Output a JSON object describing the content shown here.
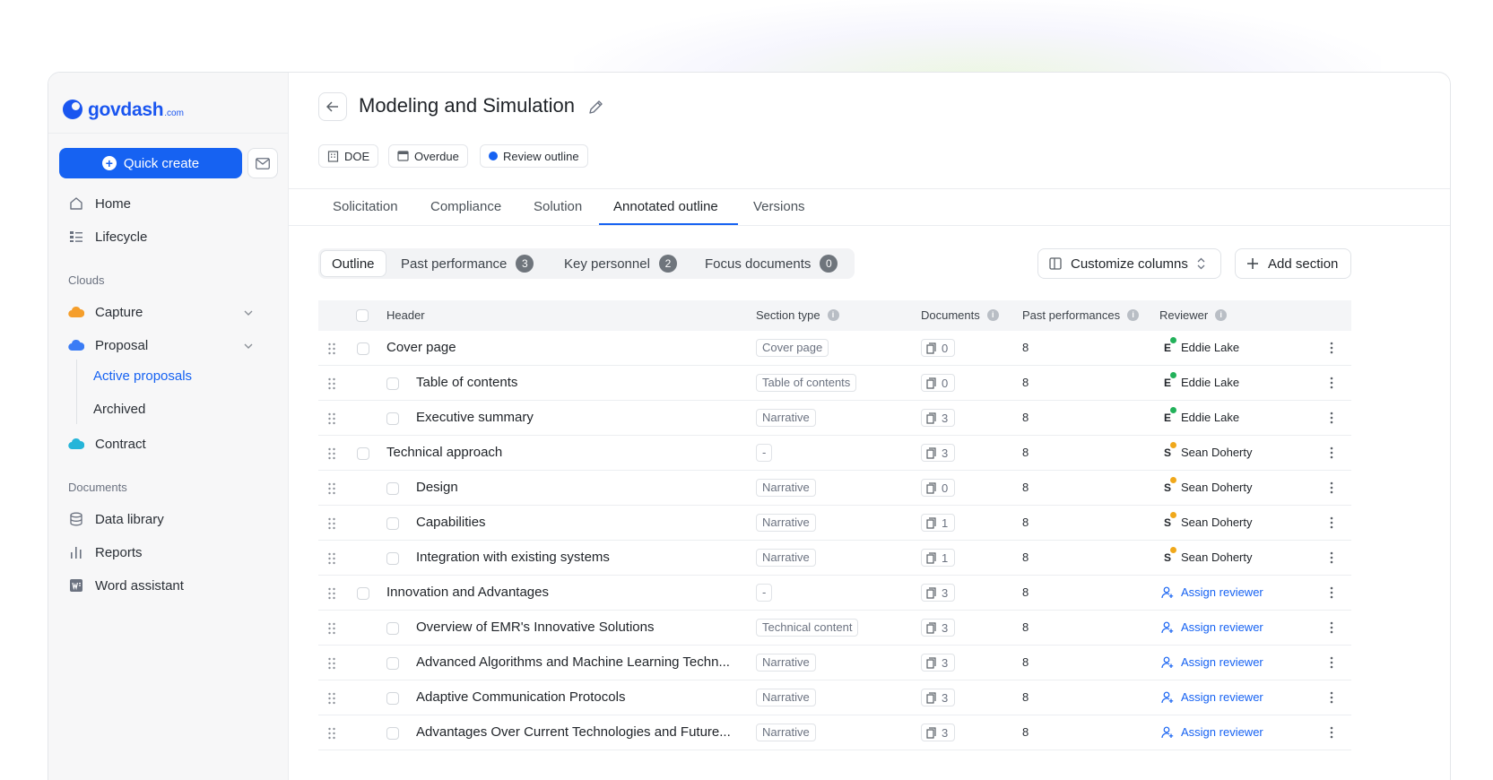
{
  "brand": {
    "name": "govdash",
    "suffix": ".com"
  },
  "sidebar": {
    "quick_create": "Quick create",
    "nav": [
      {
        "label": "Home",
        "icon": "home-icon"
      },
      {
        "label": "Lifecycle",
        "icon": "lifecycle-icon"
      }
    ],
    "clouds_heading": "Clouds",
    "clouds": [
      {
        "label": "Capture",
        "icon": "cloud-orange-icon"
      },
      {
        "label": "Proposal",
        "icon": "cloud-blue-icon"
      },
      {
        "label": "Contract",
        "icon": "cloud-teal-icon"
      }
    ],
    "proposal_sub": [
      {
        "label": "Active proposals",
        "active": true
      },
      {
        "label": "Archived",
        "active": false
      }
    ],
    "documents_heading": "Documents",
    "documents": [
      {
        "label": "Data library",
        "icon": "database-icon"
      },
      {
        "label": "Reports",
        "icon": "bar-chart-icon"
      },
      {
        "label": "Word assistant",
        "icon": "word-icon"
      }
    ]
  },
  "page": {
    "title": "Modeling and Simulation",
    "chips": [
      {
        "label": "DOE",
        "icon": "building-icon"
      },
      {
        "label": "Overdue",
        "icon": "calendar-icon"
      },
      {
        "label": "Review outline",
        "icon": "status-dot-icon",
        "color": "#1662f2"
      }
    ],
    "tabs": [
      "Solicitation",
      "Compliance",
      "Solution",
      "Annotated outline",
      "Versions"
    ],
    "active_tab": "Annotated outline",
    "subtabs": [
      {
        "label": "Outline",
        "count": null
      },
      {
        "label": "Past performance",
        "count": "3"
      },
      {
        "label": "Key personnel",
        "count": "2"
      },
      {
        "label": "Focus documents",
        "count": "0"
      }
    ],
    "customize_columns": "Customize columns",
    "add_section": "Add section"
  },
  "table": {
    "columns": [
      "Header",
      "Section type",
      "Documents",
      "Past performances",
      "Reviewer"
    ],
    "rows": [
      {
        "header": "Cover page",
        "indent": 0,
        "type": "Cover page",
        "docs": "0",
        "pp": "8",
        "reviewer": "Eddie Lake",
        "initial": "E",
        "status": "green"
      },
      {
        "header": "Table of contents",
        "indent": 1,
        "type": "Table of contents",
        "docs": "0",
        "pp": "8",
        "reviewer": "Eddie Lake",
        "initial": "E",
        "status": "green"
      },
      {
        "header": "Executive summary",
        "indent": 1,
        "type": "Narrative",
        "docs": "3",
        "pp": "8",
        "reviewer": "Eddie Lake",
        "initial": "E",
        "status": "green"
      },
      {
        "header": "Technical approach",
        "indent": 0,
        "type": "-",
        "docs": "3",
        "pp": "8",
        "reviewer": "Sean Doherty",
        "initial": "S",
        "status": "orange"
      },
      {
        "header": "Design",
        "indent": 1,
        "type": "Narrative",
        "docs": "0",
        "pp": "8",
        "reviewer": "Sean Doherty",
        "initial": "S",
        "status": "orange"
      },
      {
        "header": "Capabilities",
        "indent": 1,
        "type": "Narrative",
        "docs": "1",
        "pp": "8",
        "reviewer": "Sean Doherty",
        "initial": "S",
        "status": "orange"
      },
      {
        "header": "Integration with existing systems",
        "indent": 1,
        "type": "Narrative",
        "docs": "1",
        "pp": "8",
        "reviewer": "Sean Doherty",
        "initial": "S",
        "status": "orange"
      },
      {
        "header": "Innovation and Advantages",
        "indent": 0,
        "type": "-",
        "docs": "3",
        "pp": "8",
        "reviewer": "Assign reviewer",
        "initial": "",
        "status": "none"
      },
      {
        "header": "Overview of EMR's Innovative Solutions",
        "indent": 1,
        "type": "Technical content",
        "docs": "3",
        "pp": "8",
        "reviewer": "Assign reviewer",
        "initial": "",
        "status": "none"
      },
      {
        "header": "Advanced Algorithms and Machine Learning Techn...",
        "indent": 1,
        "type": "Narrative",
        "docs": "3",
        "pp": "8",
        "reviewer": "Assign reviewer",
        "initial": "",
        "status": "none"
      },
      {
        "header": "Adaptive Communication Protocols",
        "indent": 1,
        "type": "Narrative",
        "docs": "3",
        "pp": "8",
        "reviewer": "Assign reviewer",
        "initial": "",
        "status": "none"
      },
      {
        "header": "Advantages Over Current Technologies and Future...",
        "indent": 1,
        "type": "Narrative",
        "docs": "3",
        "pp": "8",
        "reviewer": "Assign reviewer",
        "initial": "",
        "status": "none"
      }
    ]
  },
  "colors": {
    "accent": "#1662f2",
    "ok": "#22b15a",
    "warn": "#f0a81b"
  }
}
